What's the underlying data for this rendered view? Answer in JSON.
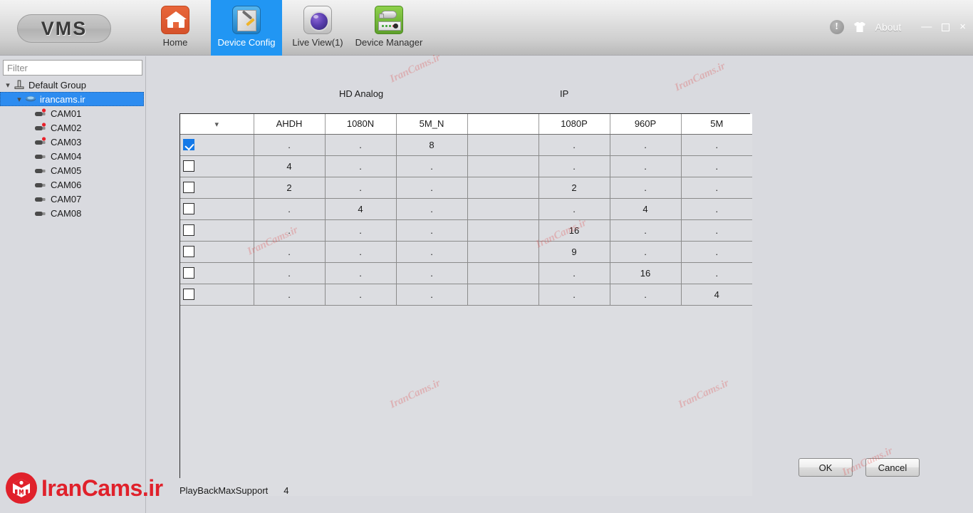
{
  "app": {
    "logo": "VMS",
    "title": "VMS - Device Config"
  },
  "toolbar": {
    "items": [
      {
        "id": "home",
        "label": "Home",
        "icon": "home-icon",
        "active": false
      },
      {
        "id": "device-config",
        "label": "Device Config",
        "icon": "device-config-icon",
        "active": true
      },
      {
        "id": "live-view",
        "label": "Live View(1)",
        "icon": "live-view-icon",
        "active": false
      },
      {
        "id": "device-manager",
        "label": "Device Manager",
        "icon": "device-manager-icon",
        "active": false
      }
    ],
    "about_label": "About",
    "info_icon": "info-icon",
    "skin_icon": "shirt-icon",
    "window_controls": {
      "minimize": "—",
      "maximize": "maximize-icon",
      "close": "×"
    }
  },
  "sidebar": {
    "filter_placeholder": "Filter",
    "filter_value": "",
    "tree": [
      {
        "level": 0,
        "label": "Default Group",
        "icon": "group-icon",
        "expanded": true,
        "selected": false
      },
      {
        "level": 1,
        "label": "irancams.ir",
        "icon": "device-icon",
        "expanded": true,
        "selected": true
      },
      {
        "level": 2,
        "label": "CAM01",
        "icon": "camera-icon-recording",
        "recording": true,
        "selected": false
      },
      {
        "level": 2,
        "label": "CAM02",
        "icon": "camera-icon-recording",
        "recording": true,
        "selected": false
      },
      {
        "level": 2,
        "label": "CAM03",
        "icon": "camera-icon-recording",
        "recording": true,
        "selected": false
      },
      {
        "level": 2,
        "label": "CAM04",
        "icon": "camera-icon",
        "recording": false,
        "selected": false
      },
      {
        "level": 2,
        "label": "CAM05",
        "icon": "camera-icon",
        "recording": false,
        "selected": false
      },
      {
        "level": 2,
        "label": "CAM06",
        "icon": "camera-icon",
        "recording": false,
        "selected": false
      },
      {
        "level": 2,
        "label": "CAM07",
        "icon": "camera-icon",
        "recording": false,
        "selected": false
      },
      {
        "level": 2,
        "label": "CAM08",
        "icon": "camera-icon",
        "recording": false,
        "selected": false
      }
    ]
  },
  "main": {
    "group_headers": [
      {
        "label": "HD Analog"
      },
      {
        "label": "IP"
      }
    ],
    "table": {
      "headers": [
        "",
        "AHDH",
        "1080N",
        "5M_N",
        "",
        "1080P",
        "960P",
        "5M"
      ],
      "header_sort_icon": "chevron-down-icon",
      "rows": [
        {
          "checked": true,
          "cells": [
            ".",
            ".",
            "8",
            "",
            ".",
            ".",
            "."
          ]
        },
        {
          "checked": false,
          "cells": [
            "4",
            ".",
            ".",
            "",
            ".",
            ".",
            "."
          ]
        },
        {
          "checked": false,
          "cells": [
            "2",
            ".",
            ".",
            "",
            "2",
            ".",
            "."
          ]
        },
        {
          "checked": false,
          "cells": [
            ".",
            "4",
            ".",
            "",
            ".",
            "4",
            "."
          ]
        },
        {
          "checked": false,
          "cells": [
            ".",
            ".",
            ".",
            "",
            "16",
            ".",
            "."
          ]
        },
        {
          "checked": false,
          "cells": [
            ".",
            ".",
            ".",
            "",
            "9",
            ".",
            "."
          ]
        },
        {
          "checked": false,
          "cells": [
            ".",
            ".",
            ".",
            "",
            ".",
            "16",
            "."
          ]
        },
        {
          "checked": false,
          "cells": [
            ".",
            ".",
            ".",
            "",
            ".",
            ".",
            "4"
          ]
        }
      ]
    },
    "playback_label": "PlayBackMaxSupport",
    "playback_value": "4",
    "buttons": {
      "ok": "OK",
      "cancel": "Cancel"
    }
  },
  "watermark": {
    "text": "IranCams.ir",
    "brand_text": "IranCams.ir",
    "brand_color": "#e0212b"
  }
}
